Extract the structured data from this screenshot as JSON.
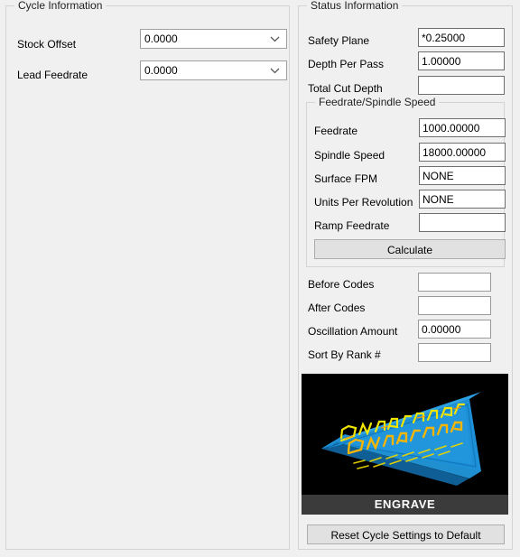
{
  "cycle_information": {
    "title": "Cycle Information",
    "fields": [
      {
        "label": "Stock Offset",
        "value": "0.0000",
        "type": "combo"
      },
      {
        "label": "Lead Feedrate",
        "value": "0.0000",
        "type": "combo"
      }
    ]
  },
  "status_information": {
    "title": "Status Information",
    "fields": [
      {
        "label": "Safety Plane",
        "value": "*0.25000"
      },
      {
        "label": "Depth Per Pass",
        "value": "1.00000"
      },
      {
        "label": "Total Cut Depth",
        "value": ""
      }
    ],
    "feedrate_spindle_speed": {
      "title": "Feedrate/Spindle Speed",
      "fields": [
        {
          "label": "Feedrate",
          "value": "1000.00000"
        },
        {
          "label": "Spindle Speed",
          "value": "18000.00000"
        },
        {
          "label": "Surface FPM",
          "value": "NONE"
        },
        {
          "label": "Units Per Revolution",
          "value": "NONE"
        },
        {
          "label": "Ramp Feedrate",
          "value": ""
        }
      ],
      "calculate_label": "Calculate"
    },
    "lower_fields": [
      {
        "label": "Before Codes",
        "value": ""
      },
      {
        "label": "After Codes",
        "value": ""
      },
      {
        "label": "Oscillation Amount",
        "value": "0.00000"
      },
      {
        "label": "Sort By Rank #",
        "value": ""
      }
    ],
    "thumbnail": {
      "caption": "ENGRAVE",
      "plate_color": "#1e90d8",
      "toolpath_color": "#f2e600",
      "background_color": "#000000"
    },
    "reset_button_label": "Reset Cycle Settings to Default"
  },
  "icons": {
    "chevron_down": "chevron-down-icon"
  }
}
